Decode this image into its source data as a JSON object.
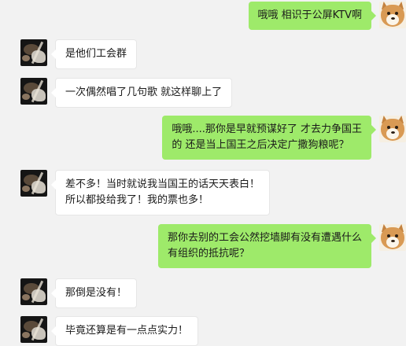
{
  "colors": {
    "background": "#f2f2f2",
    "incoming_bubble": "#ffffff",
    "outgoing_bubble": "#9eea6a"
  },
  "messages": [
    {
      "side": "right",
      "avatar": "shiba-avatar",
      "lines": [
        "哦哦 相识于公屏KTV啊"
      ]
    },
    {
      "side": "left",
      "avatar": "dark-cat-avatar",
      "lines": [
        "是他们工会群"
      ]
    },
    {
      "side": "left",
      "avatar": "dark-cat-avatar",
      "lines": [
        "一次偶然唱了几句歌 就这样聊上了"
      ]
    },
    {
      "side": "right",
      "avatar": "shiba-avatar",
      "lines": [
        "哦哦....那你是早就预谋好了  才去力争国王",
        "的  还是当上国王之后决定广撒狗粮呢？"
      ]
    },
    {
      "side": "left",
      "avatar": "dark-cat-avatar",
      "lines": [
        "差不多！当时就说我当国王的话天天表白！",
        "所以都投给我了！我的票也多！"
      ]
    },
    {
      "side": "right",
      "avatar": "shiba-avatar",
      "lines": [
        "那你去别的工会公然挖墙脚有没有遭遇什么",
        "有组织的抵抗呢？"
      ]
    },
    {
      "side": "left",
      "avatar": "dark-cat-avatar",
      "lines": [
        "那倒是没有！"
      ]
    },
    {
      "side": "left",
      "avatar": "dark-cat-avatar",
      "lines": [
        "毕竟还算是有一点点实力！"
      ]
    }
  ]
}
